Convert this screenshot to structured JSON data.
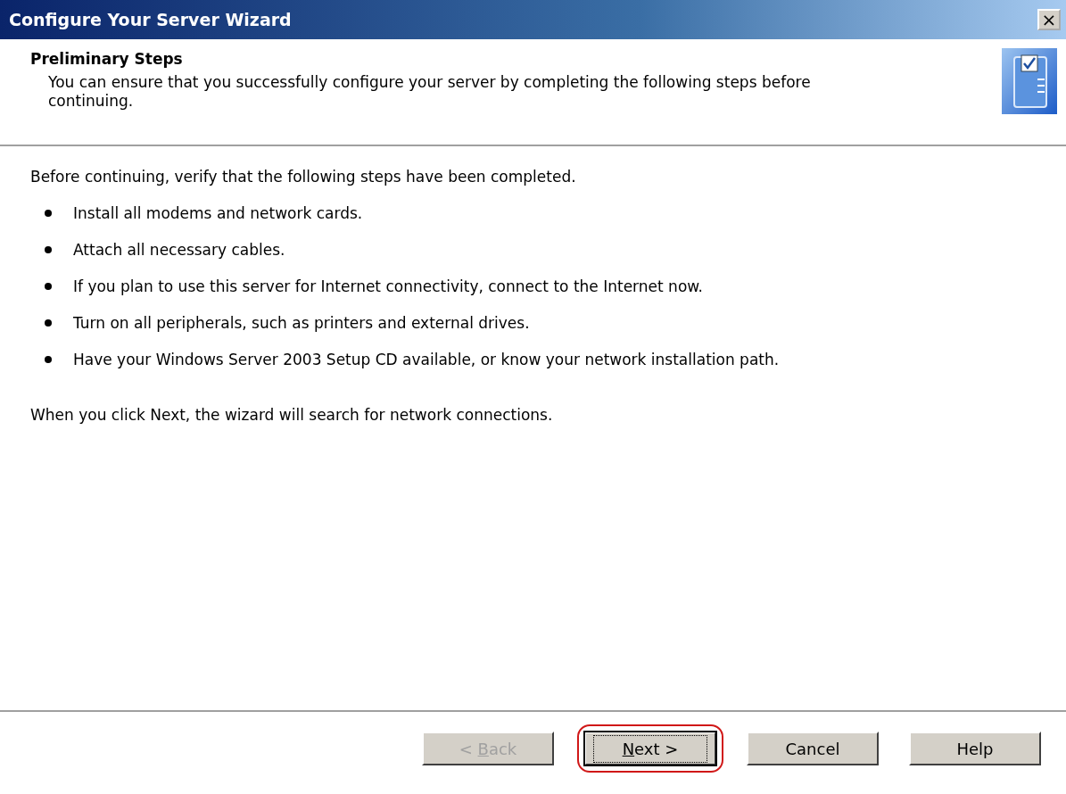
{
  "window": {
    "title": "Configure Your Server Wizard",
    "close_glyph": "×"
  },
  "header": {
    "title": "Preliminary Steps",
    "subtitle": "You can ensure that you successfully configure your server by completing the following steps before continuing."
  },
  "body": {
    "intro": "Before continuing, verify that the following steps have been completed.",
    "steps": [
      "Install all modems and network cards.",
      "Attach all necessary cables.",
      "If you plan to use this server for Internet connectivity, connect to the Internet now.",
      "Turn on all peripherals, such as printers and external drives.",
      "Have your Windows Server 2003 Setup CD available, or know your network installation path."
    ],
    "note": "When you click Next, the wizard will search for network connections."
  },
  "buttons": [
    {
      "label_before": "< ",
      "access_key": "B",
      "label_after": "ack",
      "disabled": true,
      "focused": false,
      "highlighted": false
    },
    {
      "access_key": "N",
      "label_after": "ext >",
      "disabled": false,
      "focused": true,
      "highlighted": true
    },
    {
      "label": "Cancel",
      "disabled": false,
      "focused": false,
      "highlighted": false
    },
    {
      "label": "Help",
      "disabled": false,
      "focused": false,
      "highlighted": false
    }
  ]
}
